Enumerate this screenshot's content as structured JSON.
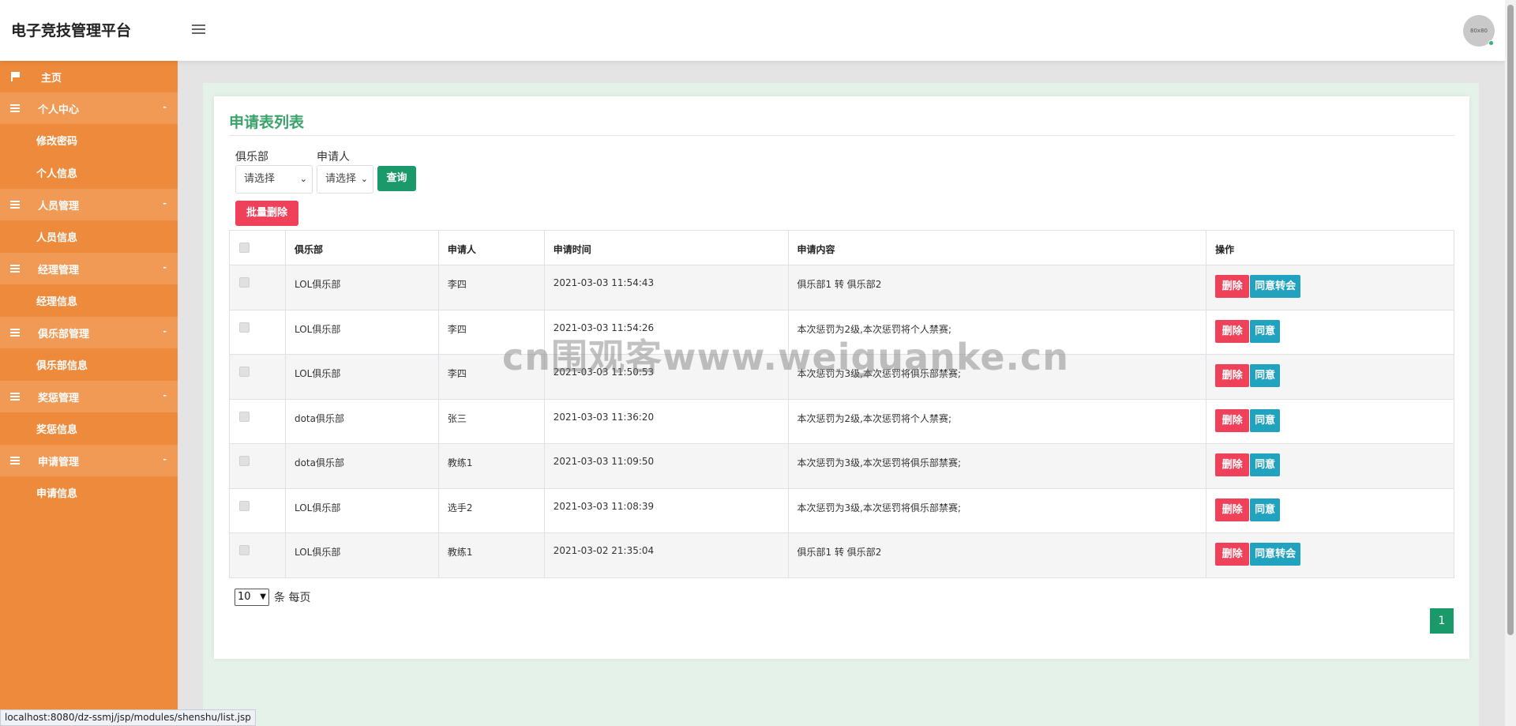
{
  "header": {
    "title": "电子竞技管理平台",
    "avatar_text": "80x80"
  },
  "sidebar": {
    "home": "主页",
    "groups": [
      {
        "label": "个人中心",
        "toggle": "-",
        "items": [
          "修改密码",
          "个人信息"
        ]
      },
      {
        "label": "人员管理",
        "toggle": "-",
        "items": [
          "人员信息"
        ]
      },
      {
        "label": "经理管理",
        "toggle": "-",
        "items": [
          "经理信息"
        ]
      },
      {
        "label": "俱乐部管理",
        "toggle": "-",
        "items": [
          "俱乐部信息"
        ]
      },
      {
        "label": "奖惩管理",
        "toggle": "-",
        "items": [
          "奖惩信息"
        ]
      },
      {
        "label": "申请管理",
        "toggle": "-",
        "items": [
          "申请信息"
        ]
      }
    ]
  },
  "main": {
    "title": "申请表列表",
    "filters": {
      "club_label": "俱乐部",
      "club_value": "请选择",
      "applicant_label": "申请人",
      "applicant_value": "请选择",
      "query_button": "查询"
    },
    "batch_delete": "批量删除",
    "table": {
      "headers": [
        "俱乐部",
        "申请人",
        "申请时间",
        "申请内容",
        "操作"
      ],
      "rows": [
        {
          "club": "LOL俱乐部",
          "applicant": "李四",
          "time": "2021-03-03 11:54:43",
          "content": "俱乐部1 转 俱乐部2",
          "delete": "删除",
          "action": "同意转会"
        },
        {
          "club": "LOL俱乐部",
          "applicant": "李四",
          "time": "2021-03-03 11:54:26",
          "content": "本次惩罚为2级,本次惩罚将个人禁赛;",
          "delete": "删除",
          "action": "同意"
        },
        {
          "club": "LOL俱乐部",
          "applicant": "李四",
          "time": "2021-03-03 11:50:53",
          "content": "本次惩罚为3级,本次惩罚将俱乐部禁赛;",
          "delete": "删除",
          "action": "同意"
        },
        {
          "club": "dota俱乐部",
          "applicant": "张三",
          "time": "2021-03-03 11:36:20",
          "content": "本次惩罚为2级,本次惩罚将个人禁赛;",
          "delete": "删除",
          "action": "同意"
        },
        {
          "club": "dota俱乐部",
          "applicant": "教练1",
          "time": "2021-03-03 11:09:50",
          "content": "本次惩罚为3级,本次惩罚将俱乐部禁赛;",
          "delete": "删除",
          "action": "同意"
        },
        {
          "club": "LOL俱乐部",
          "applicant": "选手2",
          "time": "2021-03-03 11:08:39",
          "content": "本次惩罚为3级,本次惩罚将俱乐部禁赛;",
          "delete": "删除",
          "action": "同意"
        },
        {
          "club": "LOL俱乐部",
          "applicant": "教练1",
          "time": "2021-03-02 21:35:04",
          "content": "俱乐部1 转 俱乐部2",
          "delete": "删除",
          "action": "同意转会"
        }
      ]
    },
    "pagination": {
      "page_size": "10",
      "page_size_suffix": "条 每页",
      "current_page": "1"
    }
  },
  "watermark": "cn围观客www.weiguanke.cn",
  "status_url": "localhost:8080/dz-ssmj/jsp/modules/shenshu/list.jsp",
  "colors": {
    "sidebar": "#ed8a3b",
    "accent_green": "#1a9a6a",
    "danger": "#f0415a",
    "info": "#21a3bf",
    "title_green": "#3aa26a"
  }
}
